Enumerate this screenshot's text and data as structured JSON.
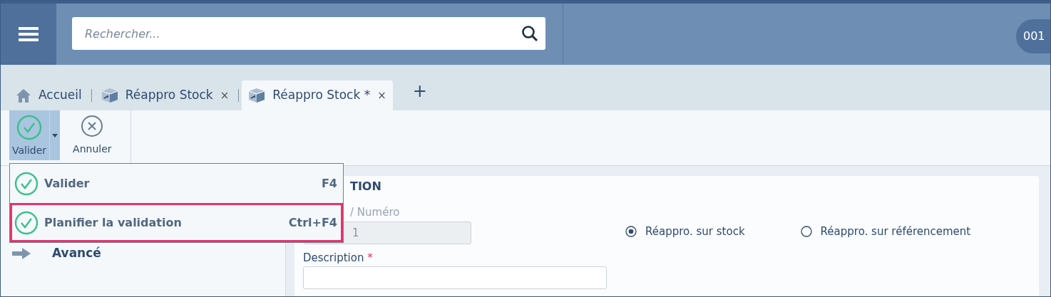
{
  "header": {
    "search": {
      "placeholder": "Rechercher..."
    },
    "user_badge": "001"
  },
  "tabs": [
    {
      "label": "Accueil",
      "kind": "home",
      "selected": false
    },
    {
      "label": "Réappro Stock",
      "kind": "doc",
      "close": "×",
      "selected": false
    },
    {
      "label": "Réappro Stock *",
      "kind": "doc",
      "close": "×",
      "selected": true
    }
  ],
  "new_tab": "+",
  "toolbar": [
    {
      "label": "Valider",
      "kind": "check",
      "selected": true,
      "has_menu": true
    },
    {
      "label": "Annuler",
      "kind": "cancel",
      "selected": false,
      "has_menu": false
    }
  ],
  "menu": [
    {
      "label": "Valider",
      "shortcut": "F4",
      "highlighted": false
    },
    {
      "label": "Planifier la validation",
      "shortcut": "Ctrl+F4",
      "highlighted": true
    }
  ],
  "side_items": [
    {
      "label": "Avancé"
    }
  ],
  "form": {
    "section_title": "TION",
    "number_label": "/ Numéro",
    "number_value": "1",
    "options": [
      {
        "label": "Réappro. sur stock",
        "selected": true
      },
      {
        "label": "Réappro. sur référencement",
        "selected": false
      }
    ],
    "description_label": "Description",
    "required_mark": "*"
  }
}
